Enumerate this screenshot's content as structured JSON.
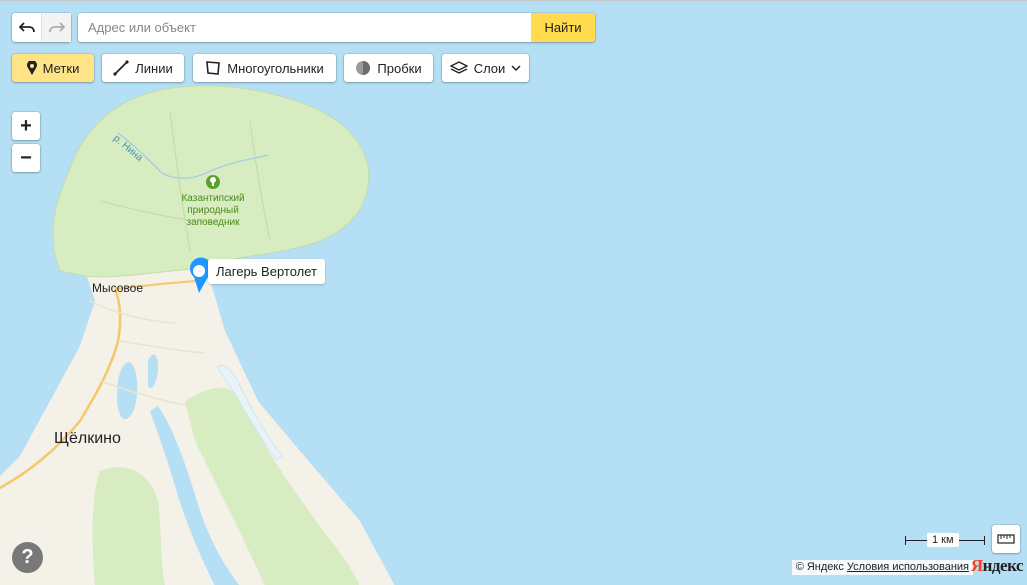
{
  "search": {
    "placeholder": "Адрес или объект",
    "button_label": "Найти"
  },
  "toolbar": {
    "tools": [
      {
        "label": "Метки",
        "icon": "placemark-icon",
        "active": true
      },
      {
        "label": "Линии",
        "icon": "line-icon",
        "active": false
      },
      {
        "label": "Многоугольники",
        "icon": "polygon-icon",
        "active": false
      },
      {
        "label": "Пробки",
        "icon": "traffic-icon",
        "active": false
      },
      {
        "label": "Слои",
        "icon": "layers-icon",
        "active": false
      }
    ]
  },
  "zoom": {
    "in": "+",
    "out": "−"
  },
  "help": "?",
  "map": {
    "labels": {
      "reserve": [
        "Казантипский",
        "природный",
        "заповедник"
      ],
      "river": "р. Нина",
      "village": "Мысовое",
      "town": "Щёлкино"
    },
    "placemark": {
      "label": "Лагерь Вертолет",
      "color": "#1e98ff"
    },
    "colors": {
      "sea": "#b5dff5",
      "forest": "#d7ecc1",
      "land": "#f3f1e8",
      "road": "#f5c869"
    }
  },
  "scale": {
    "label": "1 км"
  },
  "copyright": {
    "prefix": "© Яндекс",
    "terms": "Условия использования"
  },
  "logo": {
    "first": "Я",
    "rest": "ндекс"
  }
}
